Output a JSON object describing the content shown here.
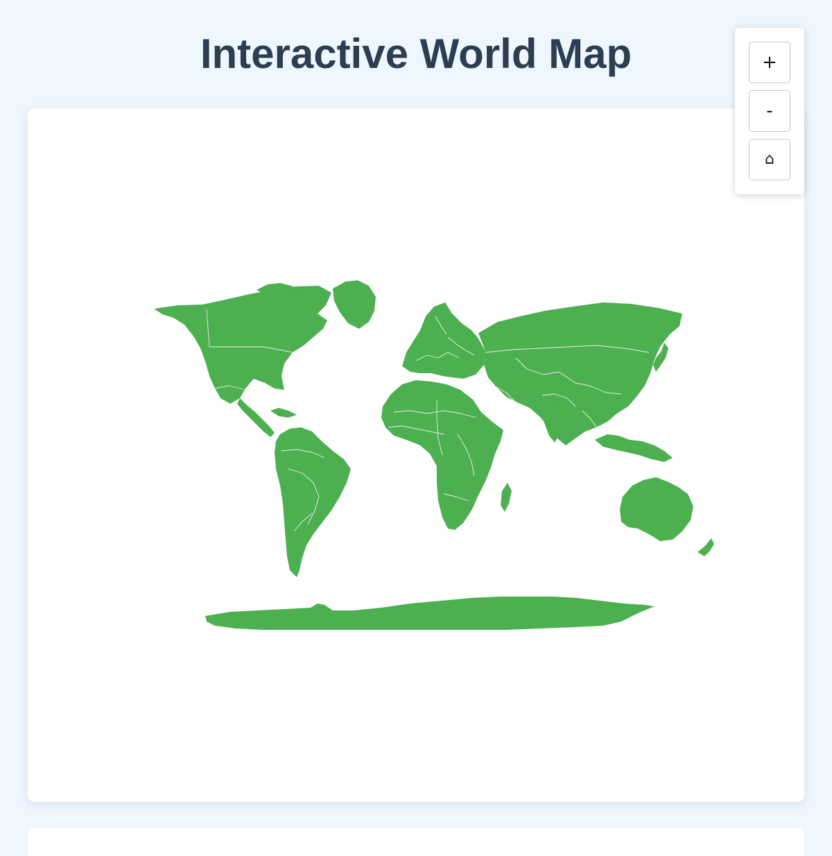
{
  "page": {
    "title": "Interactive World Map"
  },
  "map": {
    "land_color": "#4caf50",
    "border_color": "#e6f5e6",
    "background_color": "#ffffff"
  },
  "controls": {
    "zoom_in_label": "+",
    "zoom_out_label": "-",
    "reset_label": "⌂"
  }
}
